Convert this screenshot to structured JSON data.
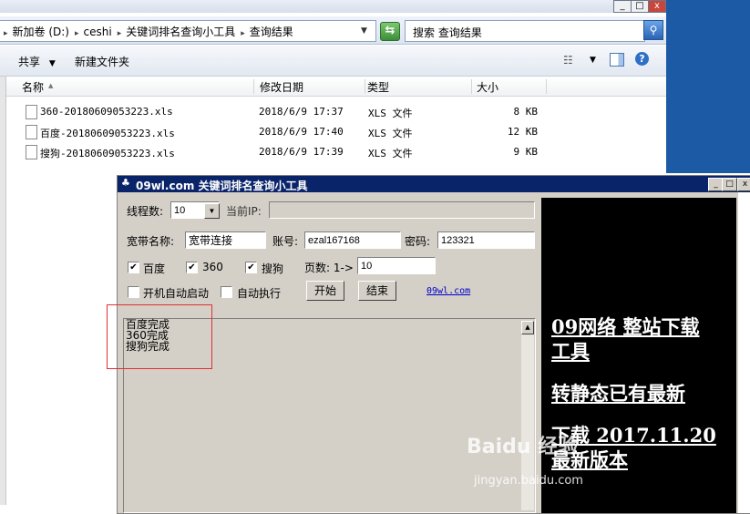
{
  "explorer": {
    "breadcrumb": [
      "新加卷 (D:)",
      "ceshi",
      "关键词排名查询小工具",
      "查询结果"
    ],
    "search_placeholder": "搜索 查询结果",
    "toolbar": {
      "share": "共享",
      "new_folder": "新建文件夹"
    },
    "columns": {
      "name": "名称",
      "date": "修改日期",
      "type": "类型",
      "size": "大小"
    },
    "files": [
      {
        "name": "360-20180609053223.xls",
        "date": "2018/6/9 17:37",
        "type": "XLS 文件",
        "size": "8 KB"
      },
      {
        "name": "百度-20180609053223.xls",
        "date": "2018/6/9 17:40",
        "type": "XLS 文件",
        "size": "12 KB"
      },
      {
        "name": "搜狗-20180609053223.xls",
        "date": "2018/6/9 17:39",
        "type": "XLS 文件",
        "size": "9 KB"
      }
    ],
    "window_buttons": {
      "minimize": "_",
      "maximize": "□",
      "close": "x"
    }
  },
  "tool": {
    "title": "09wl.com 关键词排名查询小工具",
    "threads_label": "线程数:",
    "threads_value": "10",
    "ip_label": "当前IP:",
    "ip_value": "",
    "broadband_label": "宽带名称:",
    "broadband_value": "宽带连接",
    "account_label": "账号:",
    "account_value": "ezal167168",
    "password_label": "密码:",
    "password_value": "123321",
    "engines": [
      {
        "label": "百度",
        "checked": true
      },
      {
        "label": "360",
        "checked": true
      },
      {
        "label": "搜狗",
        "checked": true
      }
    ],
    "pages_label": "页数: 1->",
    "pages_value": "10",
    "autostart_label": "开机自动启动",
    "autorun_label": "自动执行",
    "start_button": "开始",
    "stop_button": "结束",
    "link": "09wl.com",
    "log": "百度完成\n360完成\n搜狗完成",
    "ad_lines": [
      "09网络 整站下载",
      "工具",
      "转静态已有最新",
      "下载 2017.11.20",
      "最新版本"
    ],
    "watermark": "Baidu 经验",
    "watermark_sub": "jingyan.baidu.com",
    "window_buttons": {
      "minimize": "_",
      "maximize": "□",
      "close": "x"
    }
  }
}
